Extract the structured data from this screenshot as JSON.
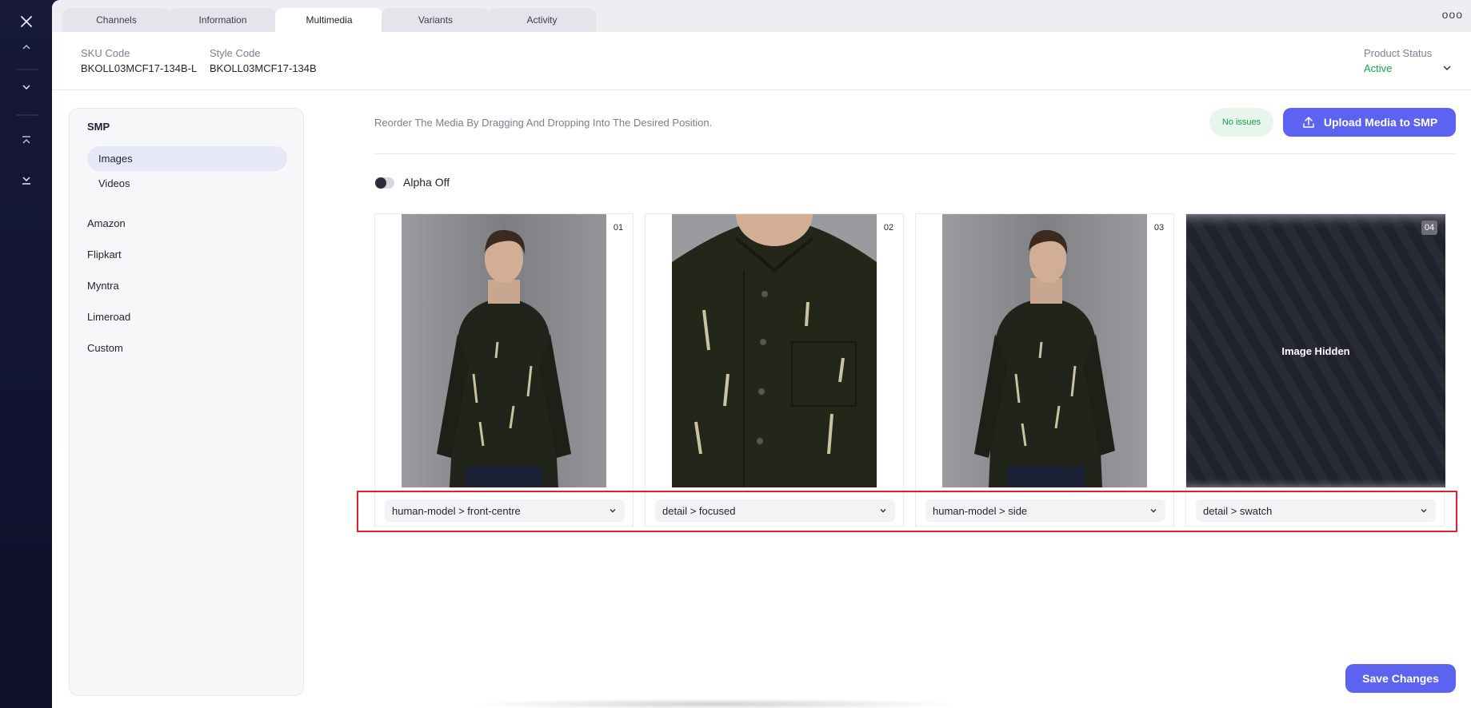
{
  "tabs": [
    {
      "label": "Channels"
    },
    {
      "label": "Information"
    },
    {
      "label": "Multimedia",
      "active": true
    },
    {
      "label": "Variants"
    },
    {
      "label": "Activity"
    }
  ],
  "header": {
    "sku_label": "SKU Code",
    "sku_value": "BKOLL03MCF17-134B-L",
    "style_label": "Style Code",
    "style_value": "BKOLL03MCF17-134B",
    "status_label": "Product Status",
    "status_value": "Active",
    "more_icon": "ooo"
  },
  "sidenav": {
    "heading": "SMP",
    "sub_items": [
      {
        "label": "Images",
        "active": true
      },
      {
        "label": "Videos"
      }
    ],
    "items": [
      {
        "label": "Amazon"
      },
      {
        "label": "Flipkart"
      },
      {
        "label": "Myntra"
      },
      {
        "label": "Limeroad"
      },
      {
        "label": "Custom"
      }
    ]
  },
  "toolbar": {
    "hint": "Reorder The Media By Dragging And Dropping Into The Desired Position.",
    "badge": "No issues",
    "upload_label": "Upload Media to SMP"
  },
  "alpha": {
    "label": "Alpha Off",
    "on": false
  },
  "media": [
    {
      "number": "01",
      "tag": "human-model > front-centre"
    },
    {
      "number": "02",
      "tag": "detail > focused"
    },
    {
      "number": "03",
      "tag": "human-model > side"
    },
    {
      "number": "04",
      "tag": "detail > swatch",
      "hidden_label": "Image Hidden"
    }
  ],
  "save_label": "Save Changes",
  "colors": {
    "accent": "#5b63f0",
    "status_active": "#1aa34a",
    "highlight": "#e0202c",
    "rail": "#17183a"
  }
}
